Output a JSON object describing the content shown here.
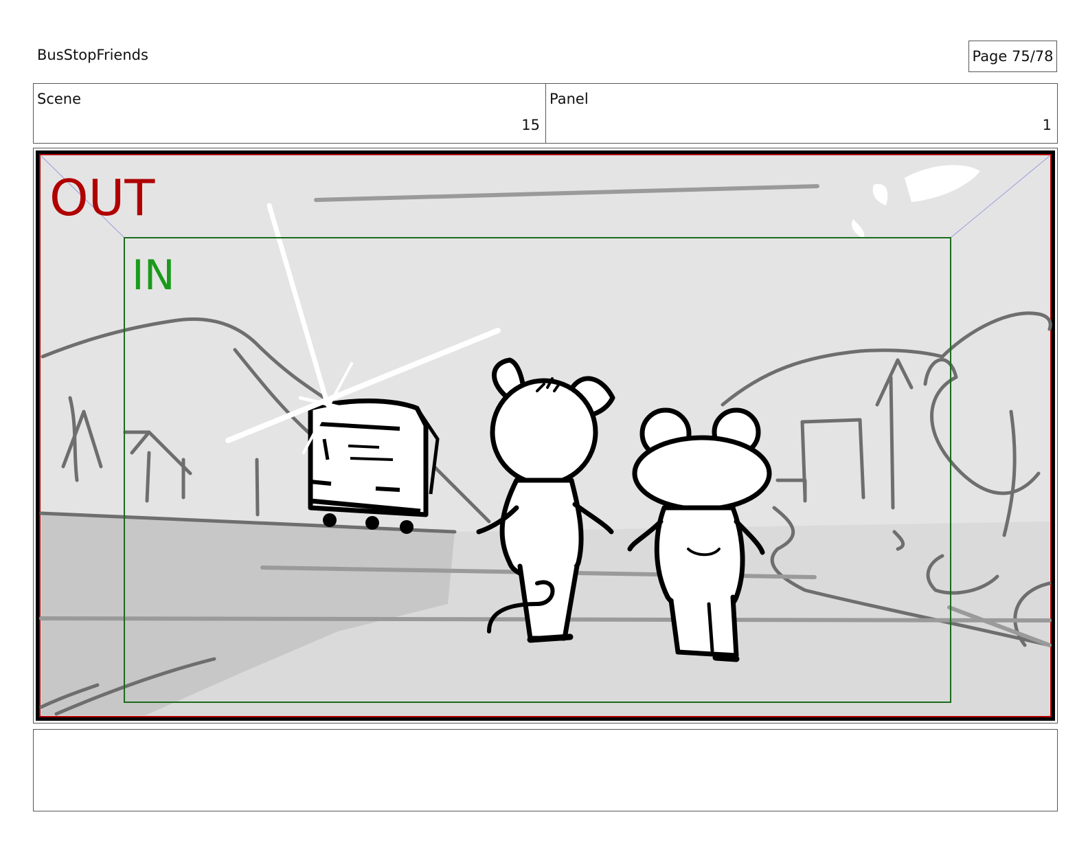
{
  "header": {
    "project_title": "BusStopFriends",
    "page_label": "Page 75/78"
  },
  "info": {
    "scene_label": "Scene",
    "scene_number": "15",
    "panel_label": "Panel",
    "panel_number": "1"
  },
  "frame": {
    "out_label": "OUT",
    "in_label": "IN",
    "out_color": "#b00000",
    "in_color": "#1a9a1a"
  },
  "notes": {
    "text": ""
  }
}
